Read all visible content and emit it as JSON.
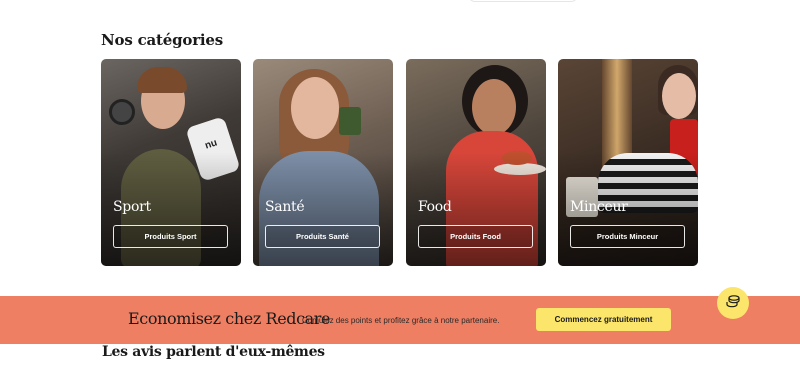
{
  "categories": {
    "title": "Nos catégories",
    "items": [
      {
        "title": "Sport",
        "button": "Produits Sport"
      },
      {
        "title": "Santé",
        "button": "Produits Santé"
      },
      {
        "title": "Food",
        "button": "Produits Food"
      },
      {
        "title": "Minceur",
        "button": "Produits Minceur"
      }
    ]
  },
  "banner": {
    "title": "Economisez chez Redcare",
    "text": "Cumulez des points et profitez grâce à notre partenaire.",
    "cta": "Commencez gratuitement",
    "background": "#ef7f63",
    "cta_color": "#fbe56a"
  },
  "fab": {
    "icon": "coins-icon"
  },
  "reviews": {
    "title": "Les avis parlent d'eux-mêmes"
  }
}
